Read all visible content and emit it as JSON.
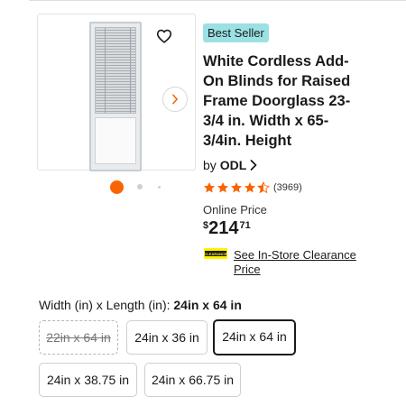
{
  "product": {
    "badge": "Best Seller",
    "title": "White Cordless Add-On Blinds for Raised Frame Doorglass 23-3/4 in. Width x 65-3/4in. Height",
    "brand_prefix": "by",
    "brand": "ODL",
    "rating": 4.5,
    "review_count": "(3969)",
    "price_label": "Online Price",
    "price_symbol": "$",
    "price_whole": "214",
    "price_cents": "71",
    "clearance_link": "See In-Store Clearance Price",
    "clearance_icon_text": "CLEARANCE"
  },
  "gallery": {
    "image_count_dots": 3,
    "active_index": 0
  },
  "size": {
    "label": "Width (in) x Length (in):",
    "selected_value": "24in x 64 in",
    "options": [
      {
        "label": "22in x 64 in",
        "state": "unavailable"
      },
      {
        "label": "24in x 36 in",
        "state": "available"
      },
      {
        "label": "24in x 64 in",
        "state": "selected"
      },
      {
        "label": "24in x 38.75 in",
        "state": "available"
      },
      {
        "label": "24in x 66.75 in",
        "state": "available"
      }
    ]
  },
  "colors": {
    "accent": "#f96302",
    "badge_bg": "#9be1e3",
    "text": "#1a1a1a"
  },
  "icons": {
    "favorite": "heart-outline-icon",
    "next": "chevron-right-icon",
    "brand_link": "chevron-right-icon",
    "star": "star-icon"
  }
}
